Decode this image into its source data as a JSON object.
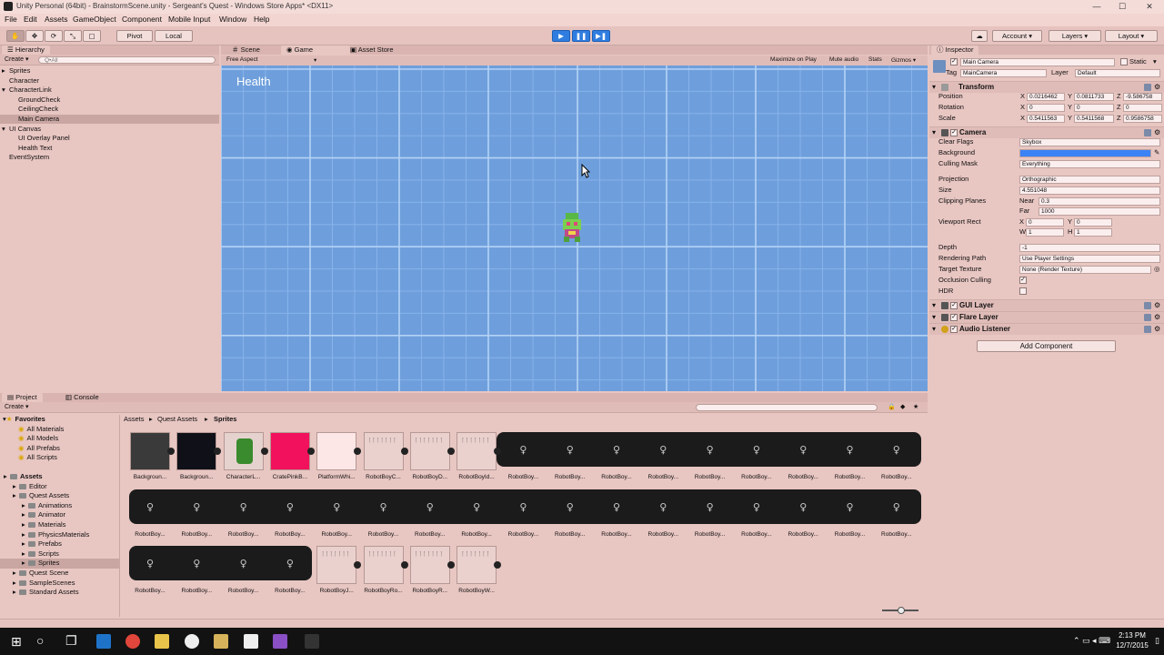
{
  "window": {
    "title": "Unity Personal (64bit) - BrainstormScene.unity - Sergeant's Quest - Windows Store Apps* <DX11>",
    "minimize": "—",
    "maximize": "☐",
    "close": "✕"
  },
  "menu": [
    "File",
    "Edit",
    "Assets",
    "GameObject",
    "Component",
    "Mobile Input",
    "Window",
    "Help"
  ],
  "toolbar": {
    "pivot": "Pivot",
    "local": "Local",
    "account": "Account",
    "layers": "Layers",
    "layout": "Layout"
  },
  "hierarchy": {
    "tab": "Hierarchy",
    "create": "Create",
    "search_placeholder": "Q•All",
    "items": [
      {
        "label": "Sprites",
        "indent": 0,
        "expander": "▸"
      },
      {
        "label": "Character",
        "indent": 0,
        "expander": ""
      },
      {
        "label": "CharacterLink",
        "indent": 0,
        "expander": "▾"
      },
      {
        "label": "GroundCheck",
        "indent": 1,
        "expander": ""
      },
      {
        "label": "CeilingCheck",
        "indent": 1,
        "expander": ""
      },
      {
        "label": "Main Camera",
        "indent": 1,
        "expander": "",
        "selected": true
      },
      {
        "label": "UI Canvas",
        "indent": 0,
        "expander": "▾"
      },
      {
        "label": "UI Overlay Panel",
        "indent": 1,
        "expander": ""
      },
      {
        "label": "Health Text",
        "indent": 1,
        "expander": ""
      },
      {
        "label": "EventSystem",
        "indent": 0,
        "expander": ""
      }
    ]
  },
  "center_tabs": {
    "scene": "Scene",
    "game": "Game",
    "asset_store": "Asset Store"
  },
  "game": {
    "aspect": "Free Aspect",
    "maximize_on_play": "Maximize on Play",
    "mute_audio": "Mute audio",
    "stats": "Stats",
    "gizmos": "Gizmos",
    "health_label": "Health"
  },
  "inspector": {
    "tab": "Inspector",
    "object_name": "Main Camera",
    "static": "Static",
    "tag_label": "Tag",
    "tag_value": "MainCamera",
    "layer_label": "Layer",
    "layer_value": "Default",
    "transform": {
      "title": "Transform",
      "position_label": "Position",
      "rotation_label": "Rotation",
      "scale_label": "Scale",
      "position": {
        "x": "0.0216462",
        "y": "0.0811733",
        "z": "-9.586758"
      },
      "rotation": {
        "x": "0",
        "y": "0",
        "z": "0"
      },
      "scale": {
        "x": "0.5411563",
        "y": "0.5411568",
        "z": "0.9586758"
      }
    },
    "camera": {
      "title": "Camera",
      "clear_flags_label": "Clear Flags",
      "clear_flags": "Skybox",
      "background_label": "Background",
      "culling_mask_label": "Culling Mask",
      "culling_mask": "Everything",
      "projection_label": "Projection",
      "projection": "Orthographic",
      "size_label": "Size",
      "size": "4.551048",
      "clipping_label": "Clipping Planes",
      "near_label": "Near",
      "near": "0.3",
      "far_label": "Far",
      "far": "1000",
      "viewport_label": "Viewport Rect",
      "vx": "0",
      "vy": "0",
      "vw": "1",
      "vh": "1",
      "depth_label": "Depth",
      "depth": "-1",
      "rendering_path_label": "Rendering Path",
      "rendering_path": "Use Player Settings",
      "target_texture_label": "Target Texture",
      "target_texture": "None (Render Texture)",
      "occlusion_label": "Occlusion Culling",
      "hdr_label": "HDR"
    },
    "components": [
      "GUI Layer",
      "Flare Layer",
      "Audio Listener"
    ],
    "add_component": "Add Component",
    "colors": {
      "background": "#3b82f6"
    }
  },
  "project": {
    "tab_project": "Project",
    "tab_console": "Console",
    "create": "Create",
    "breadcrumb": [
      "Assets",
      "Quest Assets",
      "Sprites"
    ],
    "favorites": {
      "title": "Favorites",
      "items": [
        "All Materials",
        "All Models",
        "All Prefabs",
        "All Scripts"
      ]
    },
    "tree": [
      {
        "label": "Assets",
        "indent": 0,
        "bold": true
      },
      {
        "label": "Editor",
        "indent": 1
      },
      {
        "label": "Quest Assets",
        "indent": 1
      },
      {
        "label": "Animations",
        "indent": 2
      },
      {
        "label": "Animator",
        "indent": 2
      },
      {
        "label": "Materials",
        "indent": 2
      },
      {
        "label": "PhysicsMaterials",
        "indent": 2
      },
      {
        "label": "Prefabs",
        "indent": 2
      },
      {
        "label": "Scripts",
        "indent": 2
      },
      {
        "label": "Sprites",
        "indent": 2,
        "selected": true
      },
      {
        "label": "Quest Scene",
        "indent": 1
      },
      {
        "label": "SampleScenes",
        "indent": 1
      },
      {
        "label": "Standard Assets",
        "indent": 1
      }
    ],
    "assets_row1": [
      "Backgroun...",
      "Backgroun...",
      "CharacterL...",
      "CratePinkB...",
      "PlatformWhi...",
      "RobotBoyC...",
      "RobotBoyD...",
      "RobotBoyId...",
      "RobotBoy...",
      "RobotBoy...",
      "RobotBoy...",
      "RobotBoy...",
      "RobotBoy...",
      "RobotBoy...",
      "RobotBoy...",
      "RobotBoy...",
      "RobotBoy..."
    ],
    "assets_row2": [
      "RobotBoy...",
      "RobotBoy...",
      "RobotBoy...",
      "RobotBoy...",
      "RobotBoy...",
      "RobotBoy...",
      "RobotBoy...",
      "RobotBoy...",
      "RobotBoy...",
      "RobotBoy...",
      "RobotBoy...",
      "RobotBoy...",
      "RobotBoy...",
      "RobotBoy...",
      "RobotBoy...",
      "RobotBoy...",
      "RobotBoy..."
    ],
    "assets_row3": [
      "RobotBoy...",
      "RobotBoy...",
      "RobotBoy...",
      "RobotBoy...",
      "RobotBoyJ...",
      "RobotBoyRo...",
      "RobotBoyR...",
      "RobotBoyW..."
    ]
  },
  "taskbar": {
    "time": "2:13 PM",
    "date": "12/7/2015"
  }
}
